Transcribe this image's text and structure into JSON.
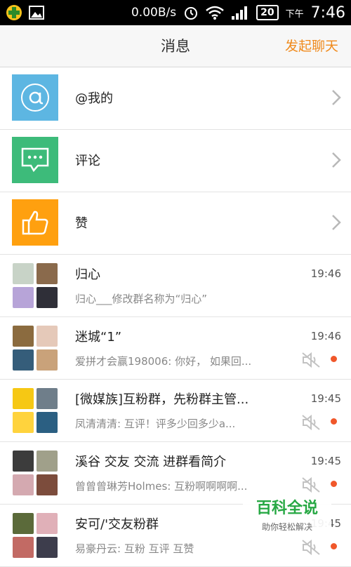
{
  "status_bar": {
    "speed": "0.00B/s",
    "battery": "20",
    "ampm": "下午",
    "time": "7:46"
  },
  "header": {
    "title": "消息",
    "action": "发起聊天"
  },
  "menu": [
    {
      "label": "@我的",
      "icon": "at-icon",
      "color": "#5db6e2"
    },
    {
      "label": "评论",
      "icon": "comment-icon",
      "color": "#3dbb7a"
    },
    {
      "label": "赞",
      "icon": "thumbs-up-icon",
      "color": "#ffa00f"
    }
  ],
  "chats": [
    {
      "title": "归心",
      "subtitle": "归心___修改群名称为“归心”",
      "time": "19:46",
      "muted": false,
      "unread": false,
      "avatars": [
        "#c8d3c7",
        "#8a6a4c",
        "#b7a4d8",
        "#2f2f38"
      ]
    },
    {
      "title": "迷城“1”",
      "subtitle": "爱拼才会赢198006: 你好， 如果回...",
      "time": "19:46",
      "muted": true,
      "unread": true,
      "avatars": [
        "#8b6b3f",
        "#e5c9b9",
        "#355d7a",
        "#c9a27a"
      ]
    },
    {
      "title": "[微媒族]互粉群，先粉群主管...",
      "subtitle": "凤清清清: 互评！评多少回多少a...",
      "time": "19:45",
      "muted": true,
      "unread": true,
      "avatars": [
        "#f6c814",
        "#6f7e8a",
        "#ffd33d",
        "#2b5f82"
      ]
    },
    {
      "title": "溪谷 交友 交流 进群看简介",
      "subtitle": "曾曾曾琳芳Holmes: 互粉啊啊啊啊...",
      "time": "19:45",
      "muted": true,
      "unread": true,
      "avatars": [
        "#3c3c3c",
        "#a0a08a",
        "#d4a9b0",
        "#7c4c3c"
      ]
    },
    {
      "title": "安可/'交友粉群",
      "subtitle": "易豪丹云: 互粉 互评 互赞",
      "time": "19:45",
      "muted": true,
      "unread": true,
      "avatars": [
        "#5b6a3a",
        "#e0b0b8",
        "#c26a64",
        "#3d3d4c"
      ]
    }
  ],
  "watermark": {
    "title": "百科全说",
    "tagline": "助你轻松解决"
  }
}
